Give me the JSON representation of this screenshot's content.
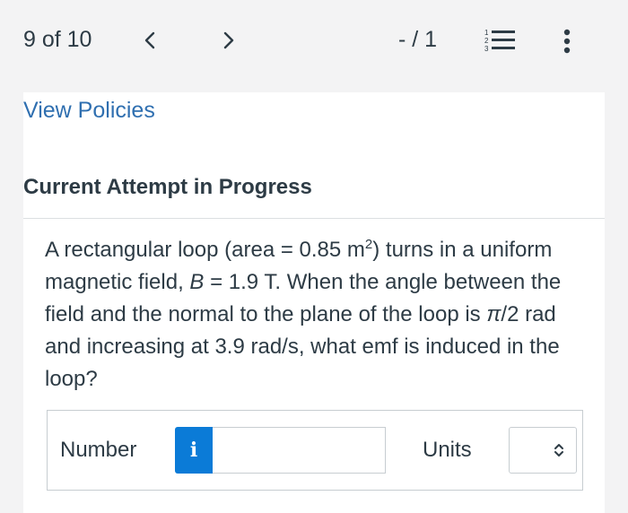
{
  "header": {
    "question_counter": "9 of 10",
    "score": "- / 1"
  },
  "icons": {
    "prev": "chevron-left-icon",
    "next": "chevron-right-icon",
    "question_list": "numbered-list-icon",
    "more": "more-vertical-icon"
  },
  "main": {
    "view_policies_link": "View Policies",
    "attempt_heading": "Current Attempt in Progress",
    "question": {
      "part1": "A rectangular loop (area = 0.85 m",
      "part1_sup": "2",
      "part2": ") turns in a uniform magnetic field, ",
      "var_b": "B",
      "part3": " = 1.9 T. When the angle between the field and the normal to the plane of the loop is ",
      "pi": "π",
      "part4": "/2 rad and increasing at 3.9 rad/s, what emf is induced in the loop?"
    },
    "answer": {
      "number_label": "Number",
      "info_button": "i",
      "number_value": "",
      "units_label": "Units",
      "units_value": ""
    }
  },
  "colors": {
    "link": "#2f6fb0",
    "info_button": "#0b7bd7",
    "text": "#2d3b45",
    "background": "#f3f3f4"
  }
}
